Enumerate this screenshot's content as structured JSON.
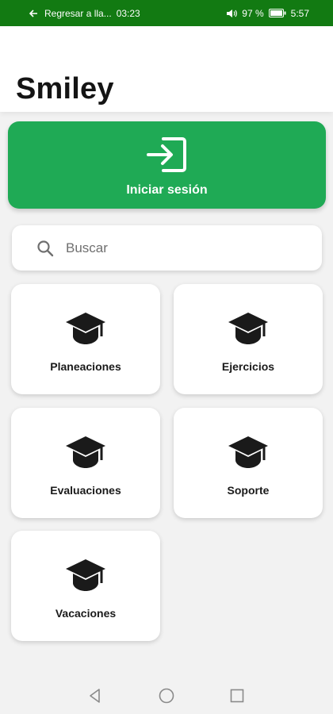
{
  "status_bar": {
    "call_text": "Regresar a lla...",
    "call_time": "03:23",
    "battery": "97 %",
    "clock": "5:57",
    "icons": [
      "back-arrow-icon",
      "volume-icon",
      "battery-icon"
    ]
  },
  "app": {
    "title": "Smiley"
  },
  "login": {
    "label": "Iniciar sesión",
    "icon": "login-icon"
  },
  "search": {
    "placeholder": "Buscar",
    "value": "",
    "icon": "search-icon"
  },
  "tiles": [
    {
      "label": "Planeaciones",
      "icon": "graduation-cap-icon"
    },
    {
      "label": "Ejercicios",
      "icon": "graduation-cap-icon"
    },
    {
      "label": "Evaluaciones",
      "icon": "graduation-cap-icon"
    },
    {
      "label": "Soporte",
      "icon": "graduation-cap-icon"
    },
    {
      "label": "Vacaciones",
      "icon": "graduation-cap-icon"
    }
  ],
  "nav": {
    "icons": [
      "nav-back-icon",
      "nav-home-icon",
      "nav-recents-icon"
    ]
  },
  "colors": {
    "status_bar": "#127a12",
    "accent": "#1faa55",
    "background": "#f2f2f2"
  }
}
